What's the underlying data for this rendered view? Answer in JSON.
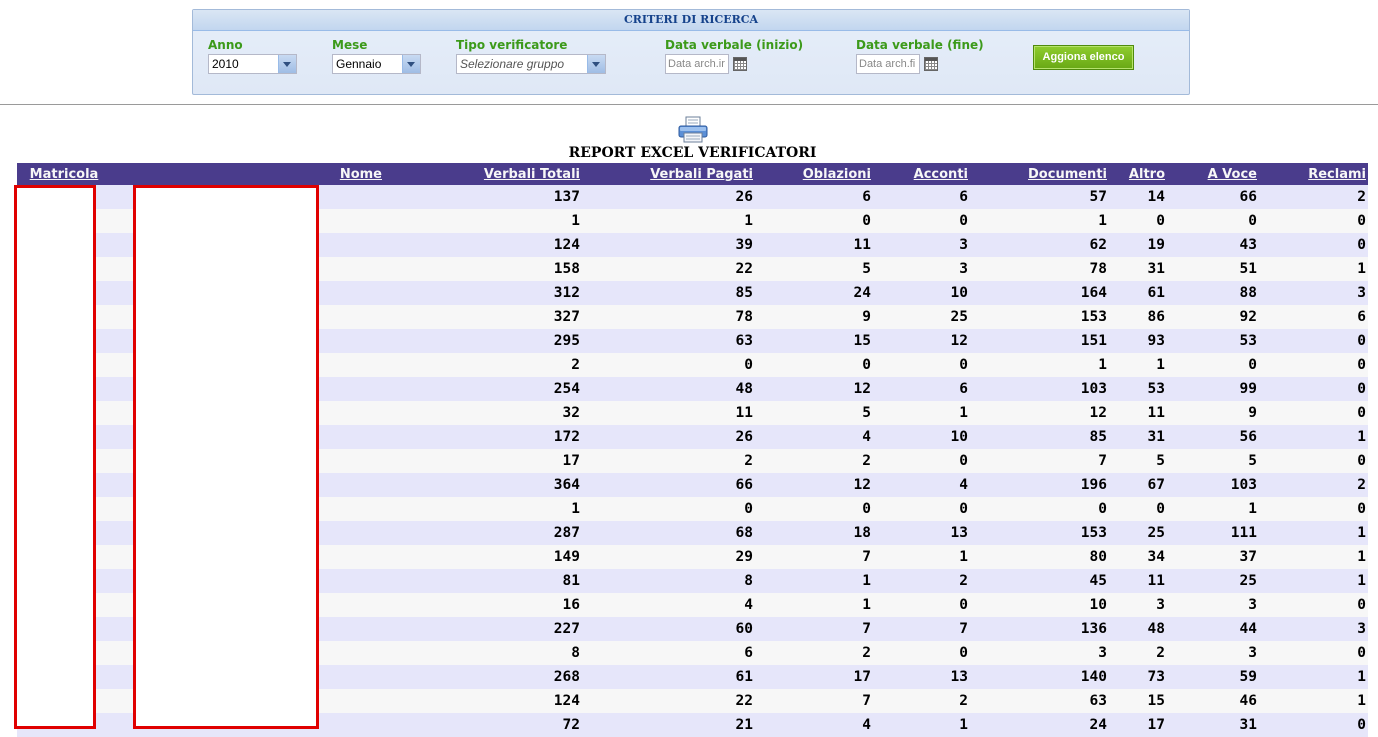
{
  "search": {
    "title": "CRITERI DI RICERCA",
    "anno": {
      "label": "Anno",
      "value": "2010"
    },
    "mese": {
      "label": "Mese",
      "value": "Gennaio"
    },
    "tipo": {
      "label": "Tipo verificatore",
      "placeholder": "Selezionare gruppo"
    },
    "data_inizio": {
      "label": "Data verbale (inizio)",
      "placeholder": "Data arch.ir"
    },
    "data_fine": {
      "label": "Data verbale (fine)",
      "placeholder": "Data arch.fi"
    },
    "refresh_button": "Aggiona elenco"
  },
  "report": {
    "title": "REPORT EXCEL VERIFICATORI",
    "print_icon": "printer-icon",
    "columns": [
      "Matricola",
      "Nome",
      "Verbali Totali",
      "Verbali Pagati",
      "Oblazioni",
      "Acconti",
      "Documenti",
      "Altro",
      "A Voce",
      "Reclami"
    ],
    "rows": [
      [
        137,
        26,
        6,
        6,
        57,
        14,
        66,
        2
      ],
      [
        1,
        1,
        0,
        0,
        1,
        0,
        0,
        0
      ],
      [
        124,
        39,
        11,
        3,
        62,
        19,
        43,
        0
      ],
      [
        158,
        22,
        5,
        3,
        78,
        31,
        51,
        1
      ],
      [
        312,
        85,
        24,
        10,
        164,
        61,
        88,
        3
      ],
      [
        327,
        78,
        9,
        25,
        153,
        86,
        92,
        6
      ],
      [
        295,
        63,
        15,
        12,
        151,
        93,
        53,
        0
      ],
      [
        2,
        0,
        0,
        0,
        1,
        1,
        0,
        0
      ],
      [
        254,
        48,
        12,
        6,
        103,
        53,
        99,
        0
      ],
      [
        32,
        11,
        5,
        1,
        12,
        11,
        9,
        0
      ],
      [
        172,
        26,
        4,
        10,
        85,
        31,
        56,
        1
      ],
      [
        17,
        2,
        2,
        0,
        7,
        5,
        5,
        0
      ],
      [
        364,
        66,
        12,
        4,
        196,
        67,
        103,
        2
      ],
      [
        1,
        0,
        0,
        0,
        0,
        0,
        1,
        0
      ],
      [
        287,
        68,
        18,
        13,
        153,
        25,
        111,
        1
      ],
      [
        149,
        29,
        7,
        1,
        80,
        34,
        37,
        1
      ],
      [
        81,
        8,
        1,
        2,
        45,
        11,
        25,
        1
      ],
      [
        16,
        4,
        1,
        0,
        10,
        3,
        3,
        0
      ],
      [
        227,
        60,
        7,
        7,
        136,
        48,
        44,
        3
      ],
      [
        8,
        6,
        2,
        0,
        3,
        2,
        3,
        0
      ],
      [
        268,
        61,
        17,
        13,
        140,
        73,
        59,
        1
      ],
      [
        124,
        22,
        7,
        2,
        63,
        15,
        46,
        1
      ],
      [
        72,
        21,
        4,
        1,
        24,
        17,
        31,
        0
      ]
    ]
  },
  "colors": {
    "header_bg": "#4a3c8c",
    "row_odd": "#e6e6fa",
    "row_even": "#f7f7f7",
    "label_green": "#3c9a1a",
    "button_green": "#7bbd22",
    "redaction": "#e00000"
  }
}
